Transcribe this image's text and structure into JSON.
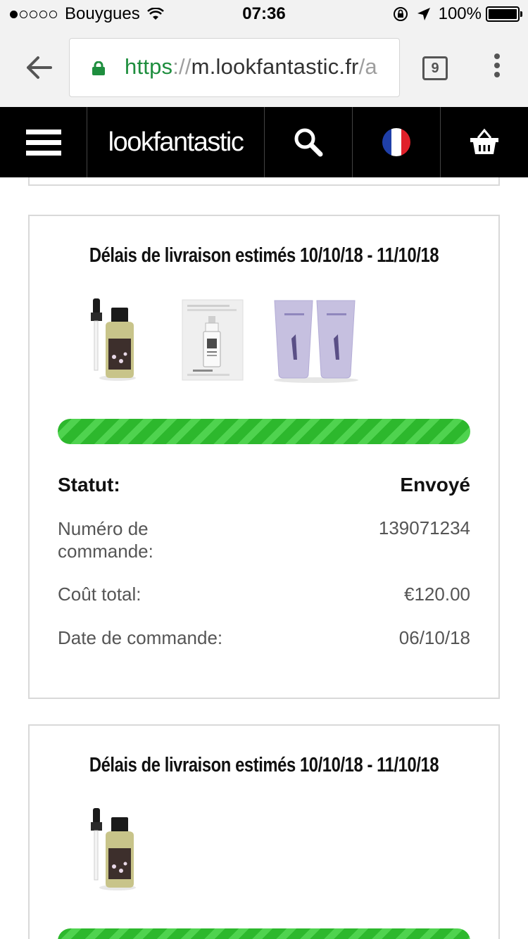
{
  "status_bar": {
    "carrier": "Bouygues",
    "time": "07:36",
    "battery": "100%",
    "signal_bars_filled": 1,
    "signal_bars_total": 5
  },
  "browser": {
    "url_scheme": "https",
    "url_sep": "://",
    "url_host": "m.lookfantastic.fr",
    "url_path_tail": "/a",
    "tab_count": "9"
  },
  "header": {
    "logo": "lookfantastic",
    "icons": [
      "menu-icon",
      "search-icon",
      "france-flag-icon",
      "basket-icon"
    ]
  },
  "orders": [
    {
      "delivery_label": "Délais de livraison estimés 10/10/18 - 11/10/18",
      "products": [
        "serum-dropper-bottle",
        "clinique-sample-card",
        "lavender-tube-pair"
      ],
      "progress": 1.0,
      "status_label": "Statut:",
      "status_value": "Envoyé",
      "order_number_label": "Numéro de commande:",
      "order_number": "139071234",
      "total_label": "Coût total:",
      "total": "€120.00",
      "date_label": "Date de commande:",
      "date": "06/10/18"
    },
    {
      "delivery_label": "Délais de livraison estimés 10/10/18 - 11/10/18",
      "products": [
        "serum-dropper-bottle"
      ],
      "progress": 1.0
    }
  ],
  "colors": {
    "progress_green": "#2db82d",
    "header_bg": "#000000",
    "url_green": "#1e8e3e"
  }
}
